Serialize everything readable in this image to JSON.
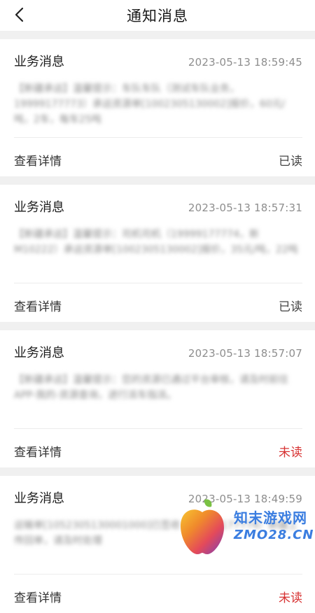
{
  "header": {
    "title": "通知消息",
    "back_icon": "chevron-left-icon"
  },
  "messages": [
    {
      "title": "业务消息",
      "time": "2023-05-13 18:59:45",
      "body": "【新疆承运】温馨提示：车队车队（测试车队业务，19999177773）承运资源单[1002305130002]报价，60元/吨，2车，每车25吨",
      "action": "查看详情",
      "status": "已读"
    },
    {
      "title": "业务消息",
      "time": "2023-05-13 18:57:31",
      "body": "【新疆承运】温馨提示：司机司机（19999177774，新M10222）承运资源单[1002305130002]报价，35元/吨，22吨",
      "action": "查看详情",
      "status": "已读"
    },
    {
      "title": "业务消息",
      "time": "2023-05-13 18:57:07",
      "body": "【新疆承运】温馨提示：您的资源已通过平台审核，请及时前往APP-我的-资源查询，进行派车指派。",
      "action": "查看详情",
      "status": "未读"
    },
    {
      "title": "业务消息",
      "time": "2023-05-13 18:49:59",
      "body": "运输单[1052305130001000]已签收（19999177774）新疆上传回单，请及时处理",
      "action": "查看详情",
      "status": "未读"
    }
  ],
  "watermark": {
    "name": "知末游戏网",
    "url": "ZMO28.CN"
  },
  "colors": {
    "unread": "#d73232",
    "read": "#444444",
    "background": "#f0f0f0"
  }
}
